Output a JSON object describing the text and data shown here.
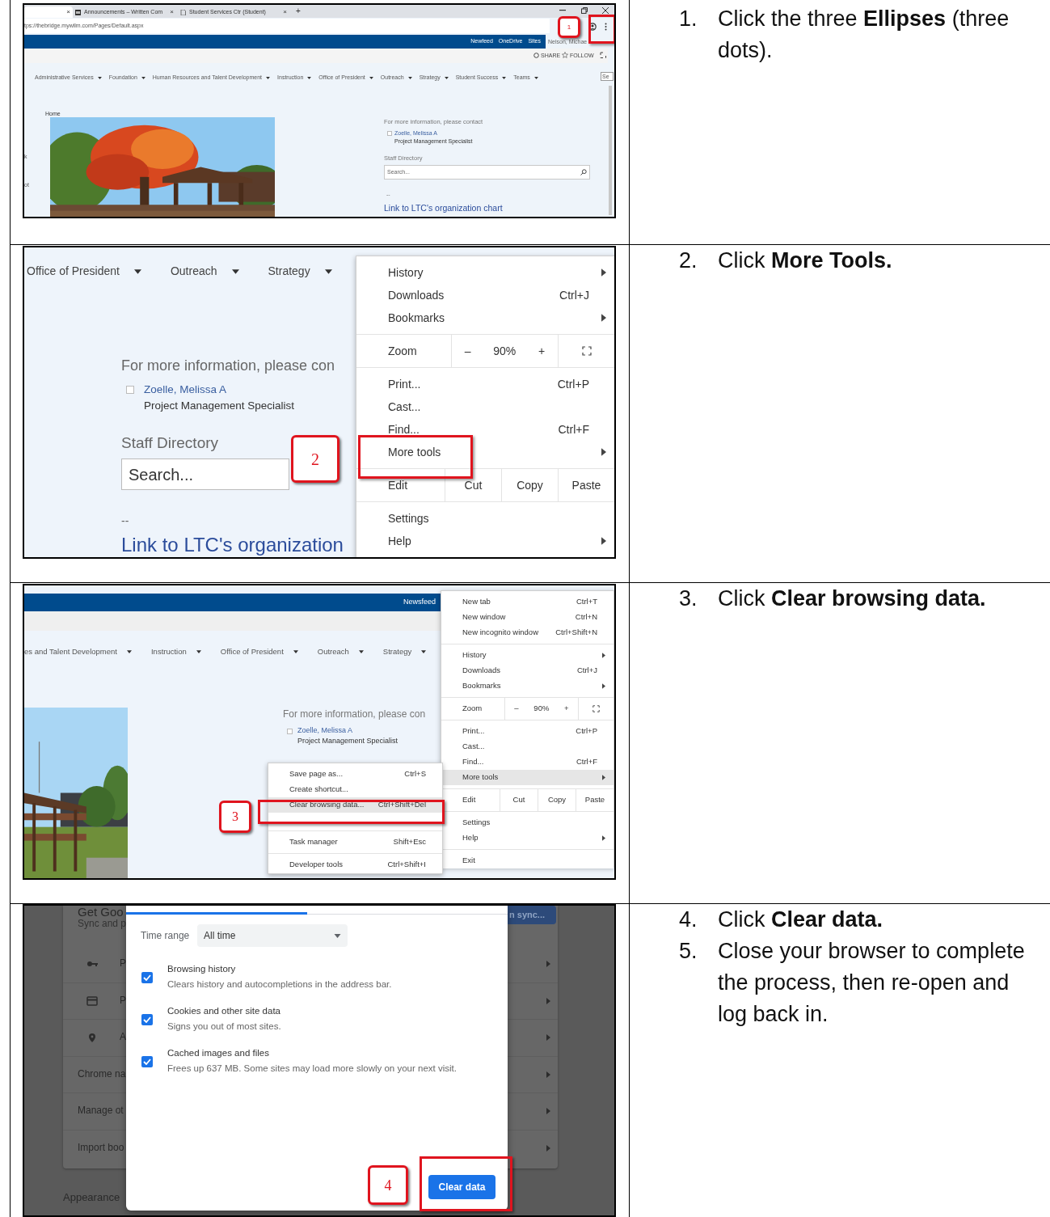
{
  "steps": [
    {
      "screenshot": {
        "kind": "browser_page",
        "tabs": [
          {
            "close": "×",
            "selected": true
          },
          {
            "title": "Announcements – Written Com",
            "close": "×",
            "selected": false
          },
          {
            "title": "Student Services Ctr (Student)",
            "close": "×",
            "selected": false
          }
        ],
        "new_tab": "+",
        "url": "tps://thebridge.mywilm.com/Pages/Default.aspx",
        "top_links": [
          "Newfeed",
          "OneDrive",
          "Sites"
        ],
        "user": "Nelson, Michae",
        "actions": [
          "SHARE",
          "FOLLOW"
        ],
        "nav": [
          "Administrative Services",
          "Foundation",
          "Human Resources and Talent Development",
          "Instruction",
          "Office of President",
          "Outreach",
          "Strategy",
          "Student Success",
          "Teams"
        ],
        "nav_search": "Se",
        "breadcrumb": "Home",
        "left_fragments": [
          "k",
          "ot"
        ],
        "contact": {
          "heading": "For more information, please contact",
          "checked": false,
          "name": "Zoelle, Melissa A",
          "role": "Project Management Specialist"
        },
        "directory": {
          "label": "Staff Directory",
          "placeholder": "Search..."
        },
        "separator": "--",
        "link": "Link to LTC's organization chart",
        "callout": "1"
      },
      "instructions": [
        {
          "number": "1.",
          "text": "Click the three **Ellipses** (three dots)."
        }
      ]
    },
    {
      "screenshot": {
        "kind": "more_tools_menu",
        "nav": [
          "Office of President",
          "Outreach",
          "Strategy"
        ],
        "contact": {
          "heading": "For more information, please con",
          "checked": false,
          "name": "Zoelle, Melissa A",
          "role": "Project Management Specialist"
        },
        "directory": {
          "label": "Staff Directory",
          "placeholder": "Search..."
        },
        "separator": "--",
        "link": "Link to LTC's organization",
        "menu": [
          [
            {
              "kind": "item",
              "label": "History",
              "submenu": true,
              "selected": false
            },
            {
              "kind": "item",
              "label": "Downloads",
              "shortcut": "Ctrl+J",
              "selected": false
            },
            {
              "kind": "item",
              "label": "Bookmarks",
              "submenu": true,
              "selected": false
            }
          ],
          [
            {
              "kind": "zoom",
              "label": "Zoom",
              "minus": "–",
              "level_text": "90%",
              "plus": "+"
            }
          ],
          [
            {
              "kind": "item",
              "label": "Print...",
              "shortcut": "Ctrl+P",
              "selected": false
            },
            {
              "kind": "item",
              "label": "Cast...",
              "selected": false
            },
            {
              "kind": "item",
              "label": "Find...",
              "shortcut": "Ctrl+F",
              "selected": false
            },
            {
              "kind": "item",
              "label": "More tools",
              "submenu": true,
              "selected": false
            }
          ],
          [
            {
              "kind": "edit",
              "label": "Edit",
              "actions": [
                "Cut",
                "Copy",
                "Paste"
              ]
            }
          ],
          [
            {
              "kind": "item",
              "label": "Settings",
              "selected": false
            },
            {
              "kind": "item",
              "label": "Help",
              "submenu": true,
              "selected": false
            }
          ]
        ],
        "callout": "2"
      },
      "instructions": [
        {
          "number": "2.",
          "text": "Click **More Tools.**"
        }
      ]
    },
    {
      "screenshot": {
        "kind": "clear_data_submenu",
        "top_links": [
          "Newsfeed"
        ],
        "nav": [
          "es and Talent Development",
          "Instruction",
          "Office of President",
          "Outreach",
          "Strategy"
        ],
        "contact": {
          "heading": "For more information, please con",
          "checked": false,
          "name": "Zoelle, Melissa A",
          "role": "Project Management Specialist"
        },
        "menu": [
          [
            {
              "kind": "item",
              "label": "New tab",
              "shortcut": "Ctrl+T",
              "selected": false
            },
            {
              "kind": "item",
              "label": "New window",
              "shortcut": "Ctrl+N",
              "selected": false
            },
            {
              "kind": "item",
              "label": "New incognito window",
              "shortcut": "Ctrl+Shift+N",
              "selected": false
            }
          ],
          [
            {
              "kind": "item",
              "label": "History",
              "submenu": true,
              "selected": false
            },
            {
              "kind": "item",
              "label": "Downloads",
              "shortcut": "Ctrl+J",
              "selected": false
            },
            {
              "kind": "item",
              "label": "Bookmarks",
              "submenu": true,
              "selected": false
            }
          ],
          [
            {
              "kind": "zoom",
              "label": "Zoom",
              "minus": "–",
              "level_text": "90%",
              "plus": "+"
            }
          ],
          [
            {
              "kind": "item",
              "label": "Print...",
              "shortcut": "Ctrl+P",
              "selected": false
            },
            {
              "kind": "item",
              "label": "Cast...",
              "selected": false
            },
            {
              "kind": "item",
              "label": "Find...",
              "shortcut": "Ctrl+F",
              "selected": false
            },
            {
              "kind": "item",
              "label": "More tools",
              "submenu": true,
              "selected": true
            }
          ],
          [
            {
              "kind": "edit",
              "label": "Edit",
              "actions": [
                "Cut",
                "Copy",
                "Paste"
              ]
            }
          ],
          [
            {
              "kind": "item",
              "label": "Settings",
              "selected": false
            },
            {
              "kind": "item",
              "label": "Help",
              "submenu": true,
              "selected": false
            }
          ],
          [
            {
              "kind": "item",
              "label": "Exit",
              "selected": false
            }
          ]
        ],
        "submenu": [
          [
            {
              "kind": "item",
              "label": "Save page as...",
              "shortcut": "Ctrl+S",
              "selected": false
            },
            {
              "kind": "item",
              "label": "Create shortcut...",
              "selected": false
            },
            {
              "kind": "item",
              "label": "Clear browsing data...",
              "shortcut": "Ctrl+Shift+Del",
              "selected": true
            }
          ],
          [
            {
              "kind": "item",
              "label": "Task manager",
              "shortcut": "Shift+Esc",
              "selected": false
            }
          ],
          [
            {
              "kind": "item",
              "label": "Developer tools",
              "shortcut": "Ctrl+Shift+I",
              "selected": false
            }
          ]
        ],
        "callout": "3"
      },
      "instructions": [
        {
          "number": "3.",
          "text": "Click **Clear browsing data.**"
        }
      ]
    },
    {
      "screenshot": {
        "kind": "clear_data_dialog",
        "settings": {
          "title": "Get Goo",
          "subtitle": "Sync and p",
          "sync_button": "n sync...",
          "rows": [
            {
              "kind": "key",
              "label": "P"
            },
            {
              "kind": "card",
              "label": "P"
            },
            {
              "kind": "pin",
              "label": "A"
            },
            {
              "kind": "plain",
              "label": "Chrome na"
            },
            {
              "kind": "plain",
              "label": "Manage ot"
            },
            {
              "kind": "plain",
              "label": "Import boo"
            }
          ],
          "section": "Appearance"
        },
        "dialog": {
          "time_range_label": "Time range",
          "time_range_value": "All time",
          "options": [
            {
              "title": "Browsing history",
              "description": "Clears history and autocompletions in the address bar.",
              "checked": true
            },
            {
              "title": "Cookies and other site data",
              "description": "Signs you out of most sites.",
              "checked": true
            },
            {
              "title": "Cached images and files",
              "description": "Frees up 637 MB. Some sites may load more slowly on your next visit.",
              "checked": true
            }
          ],
          "button": "Clear data"
        },
        "callout": "4"
      },
      "instructions": [
        {
          "number": "4.",
          "text": "Click **Clear data.**"
        },
        {
          "number": "5.",
          "text": "Close your browser to complete the process, then re-open and log back in."
        }
      ]
    }
  ]
}
